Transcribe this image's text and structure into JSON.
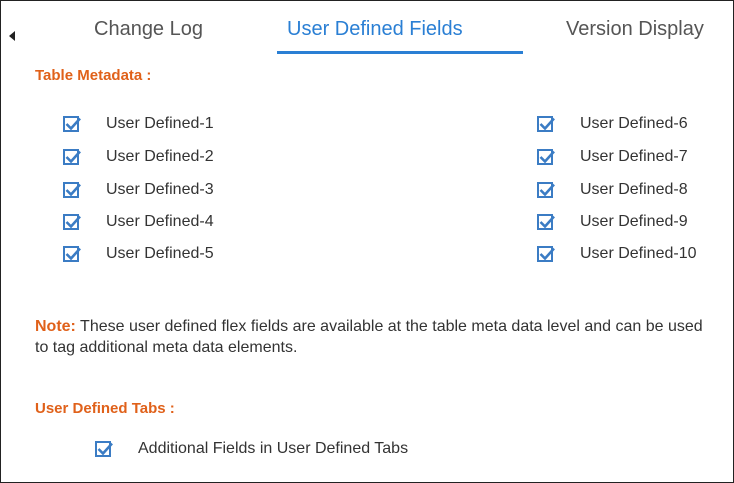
{
  "tabs": {
    "scroll_left_icon": "caret-left-icon",
    "items": [
      {
        "label": "Change Log",
        "active": false
      },
      {
        "label": "User Defined Fields",
        "active": true
      },
      {
        "label": "Version Display",
        "active": false
      }
    ]
  },
  "table_metadata": {
    "title": "Table Metadata :",
    "left_fields": [
      {
        "label": "User Defined-1",
        "checked": true
      },
      {
        "label": "User Defined-2",
        "checked": true
      },
      {
        "label": "User Defined-3",
        "checked": true
      },
      {
        "label": "User Defined-4",
        "checked": true
      },
      {
        "label": "User Defined-5",
        "checked": true
      }
    ],
    "right_fields": [
      {
        "label": "User Defined-6",
        "checked": true
      },
      {
        "label": "User Defined-7",
        "checked": true
      },
      {
        "label": "User Defined-8",
        "checked": true
      },
      {
        "label": "User Defined-9",
        "checked": true
      },
      {
        "label": "User Defined-10",
        "checked": true
      }
    ]
  },
  "note": {
    "label": "Note:",
    "text": " These user defined flex fields are available at the table meta data level and can be used to tag additional meta data elements."
  },
  "user_defined_tabs": {
    "title": "User Defined Tabs :",
    "option": {
      "label": "Additional Fields in User Defined Tabs",
      "checked": true
    }
  },
  "colors": {
    "accent_blue": "#2a7fd4",
    "section_orange": "#e0611a",
    "checkbox_blue": "#3b7cc4"
  }
}
